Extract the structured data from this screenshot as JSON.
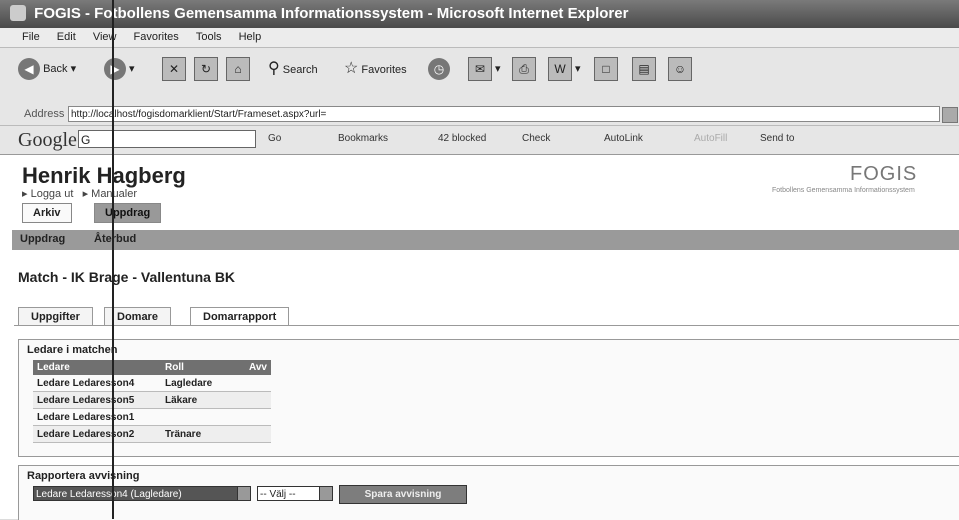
{
  "window": {
    "title": "FOGIS - Fotbollens Gemensamma Informationssystem - Microsoft Internet Explorer"
  },
  "menu": [
    "File",
    "Edit",
    "View",
    "Favorites",
    "Tools",
    "Help"
  ],
  "toolbar": {
    "back": "Back",
    "search": "Search",
    "favorites": "Favorites"
  },
  "address": {
    "label": "Address",
    "url": "http://localhost/fogisdomarklient/Start/Frameset.aspx?url="
  },
  "google_bar": {
    "logo": "Google",
    "input": "G",
    "items": [
      "Go",
      "Bookmarks",
      "42 blocked",
      "Check",
      "AutoLink",
      "AutoFill",
      "Send to"
    ]
  },
  "header": {
    "user_name": "Henrik Hagberg",
    "logout": "Logga ut",
    "manuals": "Manualer",
    "logo": "FOGIS",
    "logo_sub": "Fotbollens Gemensamma Informationssystem"
  },
  "main_tabs": [
    {
      "label": "Arkiv"
    },
    {
      "label": "Uppdrag"
    }
  ],
  "sub_nav": [
    {
      "label": "Uppdrag"
    },
    {
      "label": "Återbud"
    }
  ],
  "match_title": "Match - IK Brage - Vallentuna BK",
  "page_tabs": [
    {
      "label": "Uppgifter"
    },
    {
      "label": "Domare"
    },
    {
      "label": "Domarrapport"
    }
  ],
  "leaders": {
    "heading": "Ledare i matchen",
    "columns": [
      "Ledare",
      "Roll",
      "Avv"
    ],
    "rows": [
      {
        "name": "Ledare Ledaresson4",
        "role": "Lagledare"
      },
      {
        "name": "Ledare Ledaresson5",
        "role": "Läkare"
      },
      {
        "name": "Ledare Ledaresson1",
        "role": ""
      },
      {
        "name": "Ledare Ledaresson2",
        "role": "Tränare"
      }
    ]
  },
  "report": {
    "heading": "Rapportera avvisning",
    "selected_leader": "Ledare Ledaresson4 (Lagledare)",
    "select_placeholder": "-- Välj --",
    "save_button": "Spara avvisning"
  }
}
